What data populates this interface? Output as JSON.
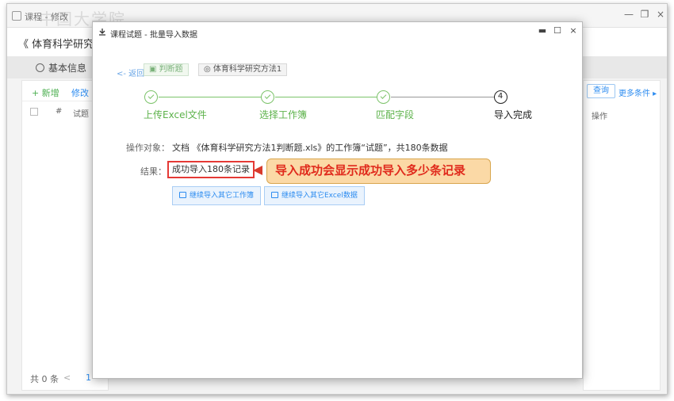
{
  "app": {
    "title": "课程 - 修改",
    "watermark": "中国大学院",
    "course_title": "《 体育科学研究方",
    "basic_info": "基本信息",
    "toolbar": {
      "add": "+ 新增",
      "edit": "修改"
    },
    "table_headers": {
      "hash": "#",
      "question": "试题",
      "ops": "操作"
    },
    "footer": {
      "total": "共 0 条",
      "prev": "<",
      "page": "1"
    },
    "search": "查询",
    "more_filter": "更多条件 ▸",
    "win_controls": {
      "minimize": "—",
      "restore": "❐",
      "close": "×"
    }
  },
  "modal": {
    "title": "课程试题 - 批量导入数据",
    "controls": {
      "minimize": "▬",
      "maximize": "☐",
      "close": "×"
    },
    "back": "返回",
    "tag_type": "判断题",
    "tag_course": "体育科学研究方法1",
    "steps": [
      {
        "label": "上传Excel文件",
        "status": "done"
      },
      {
        "label": "选择工作簿",
        "status": "done"
      },
      {
        "label": "匹配字段",
        "status": "done"
      },
      {
        "label": "导入完成",
        "status": "current",
        "number": "4"
      }
    ],
    "target_label": "操作对象：",
    "target_value": "文档 《体育科学研究方法1判断题.xls》的工作簿“试题”，共180条数据",
    "result_label": "结果：",
    "result_value": "成功导入180条记录",
    "callout": "导入成功会显示成功导入多少条记录",
    "buttons": {
      "continue_sheet": "继续导入其它工作簿",
      "continue_excel": "继续导入其它Excel数据"
    },
    "colors": {
      "done": "#7cc36a",
      "highlight": "#e53935",
      "link": "#2d8cf0"
    }
  }
}
